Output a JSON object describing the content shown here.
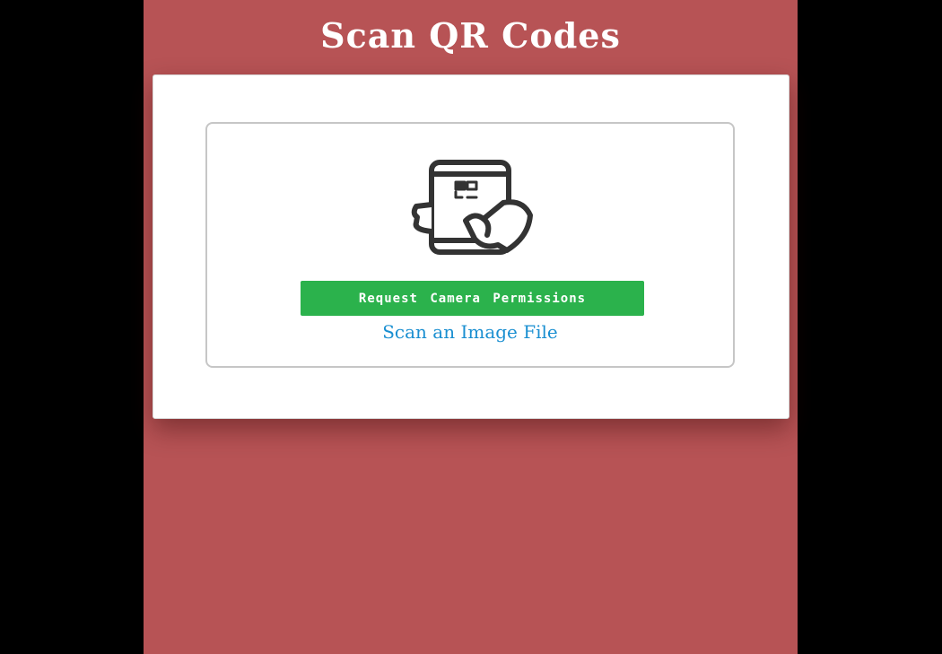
{
  "page": {
    "title": "Scan QR Codes",
    "background_color": "#b75355"
  },
  "scanner": {
    "icon": "phone-qr-scan-icon",
    "request_button_label": "Request Camera Permissions",
    "request_button_color": "#2bb24c",
    "scan_file_link_label": "Scan an Image File",
    "link_color": "#1a8fd1"
  }
}
